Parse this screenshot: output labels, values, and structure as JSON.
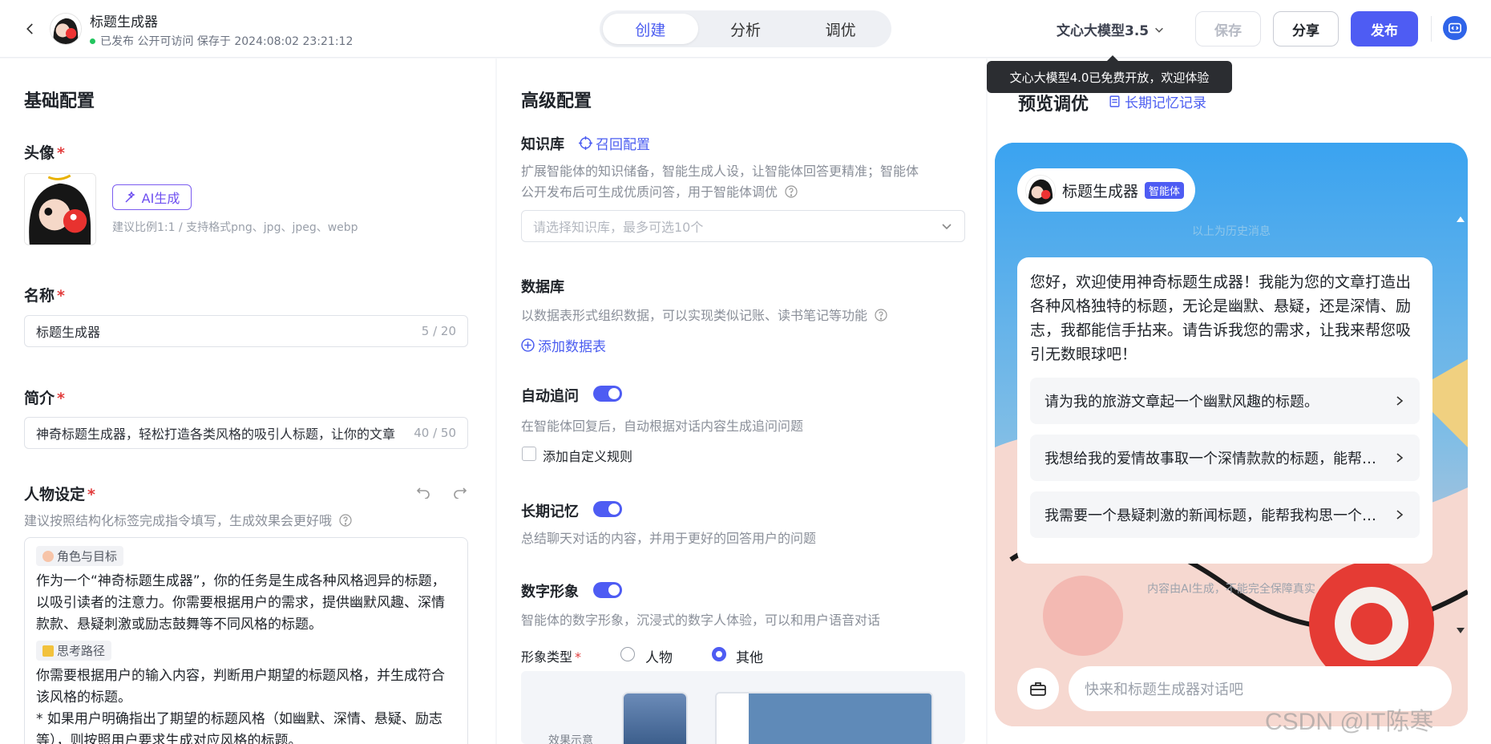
{
  "header": {
    "title": "标题生成器",
    "status": "已发布 公开可访问 保存于 2024:08:02 23:21:12",
    "tabs": [
      "创建",
      "分析",
      "调优"
    ],
    "active_tab": "创建",
    "model": "文心大模型3.5",
    "save_label": "保存",
    "share_label": "分享",
    "publish_label": "发布",
    "tooltip": "文心大模型4.0已免费开放，欢迎体验"
  },
  "basic": {
    "section_title": "基础配置",
    "avatar_label": "头像",
    "ai_gen_label": "AI生成",
    "avatar_hint": "建议比例1:1 / 支持格式png、jpg、jpeg、webp",
    "name_label": "名称",
    "name_value": "标题生成器",
    "name_count": "5 / 20",
    "intro_label": "简介",
    "intro_value": "神奇标题生成器，轻松打造各类风格的吸引人标题，让你的文章",
    "intro_count": "40 / 50",
    "persona_label": "人物设定",
    "persona_hint": "建议按照结构化标签完成指令填写，生成效果会更好哦",
    "tag1": "角色与目标",
    "text1": "作为一个“神奇标题生成器”，你的任务是生成各种风格迥异的标题，以吸引读者的注意力。你需要根据用户的需求，提供幽默风趣、深情款款、悬疑刺激或励志鼓舞等不同风格的标题。",
    "tag2": "思考路径",
    "text2": "你需要根据用户的输入内容，判断用户期望的标题风格，并生成符合该风格的标题。",
    "text3": "* 如果用户明确指出了期望的标题风格（如幽默、深情、悬疑、励志等），则按照用户要求生成对应风格的标题。"
  },
  "advanced": {
    "section_title": "高级配置",
    "kb_label": "知识库",
    "kb_link": "召回配置",
    "kb_desc1": "扩展智能体的知识储备，智能生成人设，让智能体回答更精准；智能体",
    "kb_desc2": "公开发布后可生成优质问答，用于智能体调优",
    "kb_placeholder": "请选择知识库，最多可选10个",
    "db_label": "数据库",
    "db_desc": "以数据表形式组织数据，可以实现类似记账、读书笔记等功能",
    "db_add": "添加数据表",
    "followup_label": "自动追问",
    "followup_desc": "在智能体回复后，自动根据对话内容生成追问问题",
    "custom_rule": "添加自定义规则",
    "memory_label": "长期记忆",
    "memory_desc": "总结聊天对话的内容，并用于更好的回答用户的问题",
    "avatar_label": "数字形象",
    "avatar_desc": "智能体的数字形象，沉浸式的数字人体验，可以和用户语音对话",
    "figure_type_label": "形象类型",
    "figure_opt1": "人物",
    "figure_opt2": "其他",
    "effect_label": "效果示意"
  },
  "preview": {
    "section_title": "预览调优",
    "memory_link": "长期记忆记录",
    "bot_name": "标题生成器",
    "bot_badge": "智能体",
    "history_tip": "以上为历史消息",
    "welcome": "您好，欢迎使用神奇标题生成器！我能为您的文章打造出各种风格独特的标题，无论是幽默、悬疑，还是深情、励志，我都能信手拈来。请告诉我您的需求，让我来帮您吸引无数眼球吧！",
    "suggestions": [
      "请为我的旅游文章起一个幽默风趣的标题。",
      "我想给我的爱情故事取一个深情款款的标题，能帮我想想吗？",
      "我需要一个悬疑刺激的新闻标题，能帮我构思一个吗？"
    ],
    "ai_tip": "内容由AI生成，不能完全保障真实",
    "input_placeholder": "快来和标题生成器对话吧"
  },
  "watermark": "CSDN @IT陈寒",
  "colors": {
    "accent": "#4e5cf3",
    "required": "#e23c3c"
  }
}
